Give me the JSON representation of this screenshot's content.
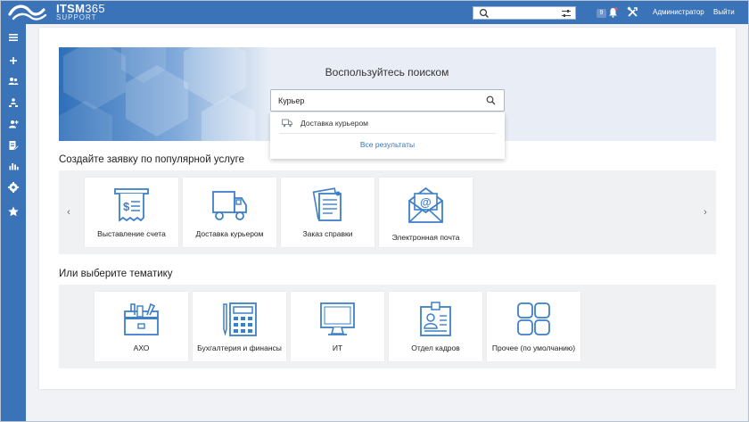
{
  "app": {
    "logo_title": "ITSM",
    "logo_title_num": "365",
    "logo_subtitle": "SUPPORT"
  },
  "topbar": {
    "search_placeholder": "",
    "notification_count": "9",
    "user_label": "Администратор",
    "logout_label": "Выйти"
  },
  "sidebar": {
    "items": [
      {
        "icon": "menu-icon"
      },
      {
        "icon": "plus-icon"
      },
      {
        "icon": "users-icon"
      },
      {
        "icon": "org-icon"
      },
      {
        "icon": "add-user-icon"
      },
      {
        "icon": "edit-doc-icon"
      },
      {
        "icon": "chart-icon"
      },
      {
        "icon": "settings-icon"
      },
      {
        "icon": "star-icon"
      }
    ]
  },
  "hero": {
    "title": "Воспользуйтесь поиском",
    "search_value": "Курьер",
    "results": [
      {
        "label": "Доставка курьером",
        "icon": "truck-icon"
      }
    ],
    "all_results_label": "Все результаты"
  },
  "popular": {
    "title": "Создайте заявку по популярной услуге",
    "tiles": [
      {
        "label": "Выставление счета",
        "icon": "invoice-icon"
      },
      {
        "label": "Доставка курьером",
        "icon": "truck-icon"
      },
      {
        "label": "Заказ справки",
        "icon": "documents-icon"
      },
      {
        "label": "Электронная почта",
        "icon": "email-icon"
      }
    ]
  },
  "topics": {
    "title": "Или выберите тематику",
    "tiles": [
      {
        "label": "АХО",
        "icon": "toolbox-icon"
      },
      {
        "label": "Бухгалтерия и финансы",
        "icon": "calculator-icon"
      },
      {
        "label": "ИТ",
        "icon": "monitor-icon"
      },
      {
        "label": "Отдел кадров",
        "icon": "id-badge-icon"
      },
      {
        "label": "Прочее (по умолчанию)",
        "icon": "grid-icon"
      }
    ]
  },
  "colors": {
    "brand": "#3a73b8",
    "icon": "#3d7fc9",
    "page_bg": "#f0f2f5"
  }
}
